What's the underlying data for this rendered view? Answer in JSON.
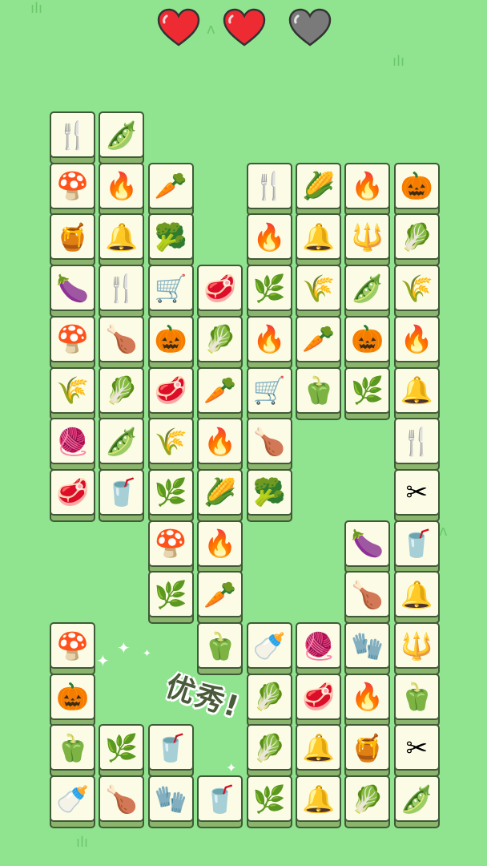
{
  "hud": {
    "lives_full": 2,
    "lives_total": 3,
    "heart_color": "#ee2b33",
    "heart_empty_color": "#7a7a7a"
  },
  "feedback": {
    "text": "优秀!"
  },
  "colors": {
    "background": "#90e490",
    "tile_face": "#fbfbe6",
    "tile_side": "#8bb46d",
    "tile_border": "#3f5a36"
  },
  "tiles": [
    {
      "col": 0,
      "row": 0,
      "icon": "fork-knife-icon",
      "glyph": "🍴"
    },
    {
      "col": 1,
      "row": 0,
      "icon": "peas-icon",
      "glyph": "🫛"
    },
    {
      "col": 0,
      "row": 1,
      "icon": "mushroom-icon",
      "glyph": "🍄"
    },
    {
      "col": 1,
      "row": 1,
      "icon": "campfire-icon",
      "glyph": "🔥"
    },
    {
      "col": 2,
      "row": 1,
      "icon": "carrot-icon",
      "glyph": "🥕"
    },
    {
      "col": 4,
      "row": 1,
      "icon": "fork-knife-icon",
      "glyph": "🍴"
    },
    {
      "col": 5,
      "row": 1,
      "icon": "corn-icon",
      "glyph": "🌽"
    },
    {
      "col": 6,
      "row": 1,
      "icon": "campfire-icon",
      "glyph": "🔥"
    },
    {
      "col": 7,
      "row": 1,
      "icon": "pumpkin-icon",
      "glyph": "🎃"
    },
    {
      "col": 0,
      "row": 2,
      "icon": "yarn-spool-icon",
      "glyph": "🍯"
    },
    {
      "col": 1,
      "row": 2,
      "icon": "bell-icon",
      "glyph": "🔔"
    },
    {
      "col": 2,
      "row": 2,
      "icon": "broccoli-icon",
      "glyph": "🥦"
    },
    {
      "col": 4,
      "row": 2,
      "icon": "campfire-icon",
      "glyph": "🔥"
    },
    {
      "col": 5,
      "row": 2,
      "icon": "bell-icon",
      "glyph": "🔔"
    },
    {
      "col": 6,
      "row": 2,
      "icon": "pitchfork-icon",
      "glyph": "🔱"
    },
    {
      "col": 7,
      "row": 2,
      "icon": "cabbage-icon",
      "glyph": "🥬"
    },
    {
      "col": 0,
      "row": 3,
      "icon": "eggplant-icon",
      "glyph": "🍆"
    },
    {
      "col": 1,
      "row": 3,
      "icon": "fork-knife-icon",
      "glyph": "🍴"
    },
    {
      "col": 2,
      "row": 3,
      "icon": "wheelbarrow-icon",
      "glyph": "🛒"
    },
    {
      "col": 3,
      "row": 3,
      "icon": "meat-icon",
      "glyph": "🥩"
    },
    {
      "col": 4,
      "row": 3,
      "icon": "grass-bush-icon",
      "glyph": "🌿"
    },
    {
      "col": 5,
      "row": 3,
      "icon": "wheat-bundle-icon",
      "glyph": "🌾"
    },
    {
      "col": 6,
      "row": 3,
      "icon": "peas-icon",
      "glyph": "🫛"
    },
    {
      "col": 7,
      "row": 3,
      "icon": "wheat-bundle-icon",
      "glyph": "🌾"
    },
    {
      "col": 0,
      "row": 4,
      "icon": "mushroom-icon",
      "glyph": "🍄"
    },
    {
      "col": 1,
      "row": 4,
      "icon": "chicken-leg-icon",
      "glyph": "🍗"
    },
    {
      "col": 2,
      "row": 4,
      "icon": "pumpkin-icon",
      "glyph": "🎃"
    },
    {
      "col": 3,
      "row": 4,
      "icon": "cabbage-icon",
      "glyph": "🥬"
    },
    {
      "col": 4,
      "row": 4,
      "icon": "campfire-icon",
      "glyph": "🔥"
    },
    {
      "col": 5,
      "row": 4,
      "icon": "carrot-icon",
      "glyph": "🥕"
    },
    {
      "col": 6,
      "row": 4,
      "icon": "pumpkin-icon",
      "glyph": "🎃"
    },
    {
      "col": 7,
      "row": 4,
      "icon": "campfire-icon",
      "glyph": "🔥"
    },
    {
      "col": 0,
      "row": 5,
      "icon": "wheat-bundle-icon",
      "glyph": "🌾"
    },
    {
      "col": 1,
      "row": 5,
      "icon": "cabbage-icon",
      "glyph": "🥬"
    },
    {
      "col": 2,
      "row": 5,
      "icon": "meat-icon",
      "glyph": "🥩"
    },
    {
      "col": 3,
      "row": 5,
      "icon": "carrot-icon",
      "glyph": "🥕"
    },
    {
      "col": 4,
      "row": 5,
      "icon": "wheelbarrow-icon",
      "glyph": "🛒"
    },
    {
      "col": 5,
      "row": 5,
      "icon": "bell-pepper-icon",
      "glyph": "🫑"
    },
    {
      "col": 6,
      "row": 5,
      "icon": "grass-bush-icon",
      "glyph": "🌿"
    },
    {
      "col": 7,
      "row": 5,
      "icon": "bell-icon",
      "glyph": "🔔"
    },
    {
      "col": 0,
      "row": 6,
      "icon": "yarn-ball-icon",
      "glyph": "🧶"
    },
    {
      "col": 1,
      "row": 6,
      "icon": "peas-icon",
      "glyph": "🫛"
    },
    {
      "col": 2,
      "row": 6,
      "icon": "wheat-bundle-icon",
      "glyph": "🌾"
    },
    {
      "col": 3,
      "row": 6,
      "icon": "campfire-icon",
      "glyph": "🔥"
    },
    {
      "col": 4,
      "row": 6,
      "icon": "chicken-leg-icon",
      "glyph": "🍗"
    },
    {
      "col": 7,
      "row": 6,
      "icon": "fork-knife-icon",
      "glyph": "🍴"
    },
    {
      "col": 0,
      "row": 7,
      "icon": "meat-icon",
      "glyph": "🥩"
    },
    {
      "col": 1,
      "row": 7,
      "icon": "lotus-root-icon",
      "glyph": "🥤"
    },
    {
      "col": 2,
      "row": 7,
      "icon": "grass-bush-icon",
      "glyph": "🌿"
    },
    {
      "col": 3,
      "row": 7,
      "icon": "corn-icon",
      "glyph": "🌽"
    },
    {
      "col": 4,
      "row": 7,
      "icon": "broccoli-icon",
      "glyph": "🥦"
    },
    {
      "col": 7,
      "row": 7,
      "icon": "scissors-icon",
      "glyph": "✂"
    },
    {
      "col": 2,
      "row": 8,
      "icon": "mushroom-icon",
      "glyph": "🍄"
    },
    {
      "col": 3,
      "row": 8,
      "icon": "campfire-icon",
      "glyph": "🔥"
    },
    {
      "col": 6,
      "row": 8,
      "icon": "eggplant-icon",
      "glyph": "🍆"
    },
    {
      "col": 7,
      "row": 8,
      "icon": "lotus-root-icon",
      "glyph": "🥤"
    },
    {
      "col": 2,
      "row": 9,
      "icon": "grass-bush-icon",
      "glyph": "🌿"
    },
    {
      "col": 3,
      "row": 9,
      "icon": "carrot-icon",
      "glyph": "🥕"
    },
    {
      "col": 6,
      "row": 9,
      "icon": "chicken-leg-icon",
      "glyph": "🍗"
    },
    {
      "col": 7,
      "row": 9,
      "icon": "bell-icon",
      "glyph": "🔔"
    },
    {
      "col": 0,
      "row": 10,
      "icon": "mushroom-icon",
      "glyph": "🍄"
    },
    {
      "col": 3,
      "row": 10,
      "icon": "bell-pepper-icon",
      "glyph": "🫑"
    },
    {
      "col": 4,
      "row": 10,
      "icon": "baby-bottle-icon",
      "glyph": "🍼"
    },
    {
      "col": 5,
      "row": 10,
      "icon": "yarn-ball-icon",
      "glyph": "🧶"
    },
    {
      "col": 6,
      "row": 10,
      "icon": "mitten-icon",
      "glyph": "🧤"
    },
    {
      "col": 7,
      "row": 10,
      "icon": "pitchfork-icon",
      "glyph": "🔱"
    },
    {
      "col": 0,
      "row": 11,
      "icon": "pumpkin-icon",
      "glyph": "🎃"
    },
    {
      "col": 4,
      "row": 11,
      "icon": "cabbage-icon",
      "glyph": "🥬"
    },
    {
      "col": 5,
      "row": 11,
      "icon": "meat-icon",
      "glyph": "🥩"
    },
    {
      "col": 6,
      "row": 11,
      "icon": "campfire-icon",
      "glyph": "🔥"
    },
    {
      "col": 7,
      "row": 11,
      "icon": "bell-pepper-icon",
      "glyph": "🫑"
    },
    {
      "col": 0,
      "row": 12,
      "icon": "bell-pepper-icon",
      "glyph": "🫑"
    },
    {
      "col": 1,
      "row": 12,
      "icon": "grass-bush-icon",
      "glyph": "🌿"
    },
    {
      "col": 2,
      "row": 12,
      "icon": "lotus-root-icon",
      "glyph": "🥤"
    },
    {
      "col": 4,
      "row": 12,
      "icon": "napa-cabbage-icon",
      "glyph": "🥬"
    },
    {
      "col": 5,
      "row": 12,
      "icon": "bell-icon",
      "glyph": "🔔"
    },
    {
      "col": 6,
      "row": 12,
      "icon": "yarn-spool-icon",
      "glyph": "🍯"
    },
    {
      "col": 7,
      "row": 12,
      "icon": "scissors-icon",
      "glyph": "✂"
    },
    {
      "col": 0,
      "row": 13,
      "icon": "baby-bottle-icon",
      "glyph": "🍼"
    },
    {
      "col": 1,
      "row": 13,
      "icon": "chicken-leg-icon",
      "glyph": "🍗"
    },
    {
      "col": 2,
      "row": 13,
      "icon": "mitten-icon",
      "glyph": "🧤"
    },
    {
      "col": 3,
      "row": 13,
      "icon": "lotus-root-icon",
      "glyph": "🥤"
    },
    {
      "col": 4,
      "row": 13,
      "icon": "grass-bush-icon",
      "glyph": "🌿"
    },
    {
      "col": 5,
      "row": 13,
      "icon": "bell-icon",
      "glyph": "🔔"
    },
    {
      "col": 6,
      "row": 13,
      "icon": "napa-cabbage-icon",
      "glyph": "🥬"
    },
    {
      "col": 7,
      "row": 13,
      "icon": "peas-icon",
      "glyph": "🫛"
    }
  ]
}
